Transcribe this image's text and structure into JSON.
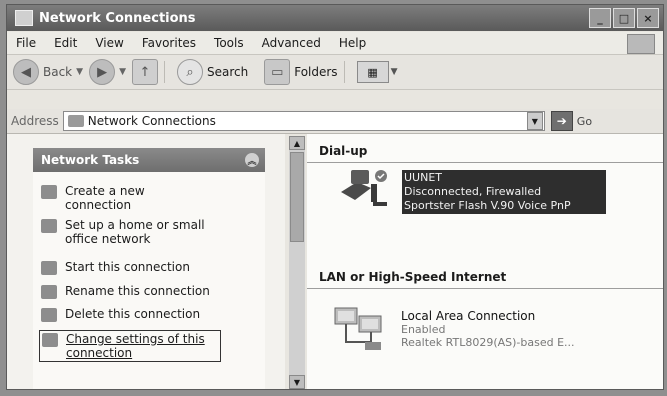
{
  "window": {
    "title": "Network Connections"
  },
  "menu": [
    "File",
    "Edit",
    "View",
    "Favorites",
    "Tools",
    "Advanced",
    "Help"
  ],
  "toolbar": {
    "back": "Back",
    "search": "Search",
    "folders": "Folders"
  },
  "address": {
    "label": "Address",
    "value": "Network Connections",
    "go": "Go"
  },
  "tasks": {
    "header": "Network Tasks",
    "items": [
      {
        "label": "Create a new connection",
        "icon": "new-connection-icon"
      },
      {
        "label": "Set up a home or small office network",
        "icon": "home-network-icon"
      },
      {
        "label": "Start this connection",
        "icon": "start-connection-icon"
      },
      {
        "label": "Rename this connection",
        "icon": "rename-icon"
      },
      {
        "label": "Delete this connection",
        "icon": "delete-icon"
      },
      {
        "label": "Change settings of this connection",
        "icon": "settings-icon"
      }
    ]
  },
  "groups": {
    "dialup": {
      "header": "Dial-up",
      "item": {
        "name": "UUNET",
        "status": "Disconnected, Firewalled",
        "device": "Sportster Flash V.90 Voice PnP"
      }
    },
    "lan": {
      "header": "LAN or High-Speed Internet",
      "item": {
        "name": "Local Area Connection",
        "status": "Enabled",
        "device": "Realtek RTL8029(AS)-based E..."
      }
    }
  }
}
